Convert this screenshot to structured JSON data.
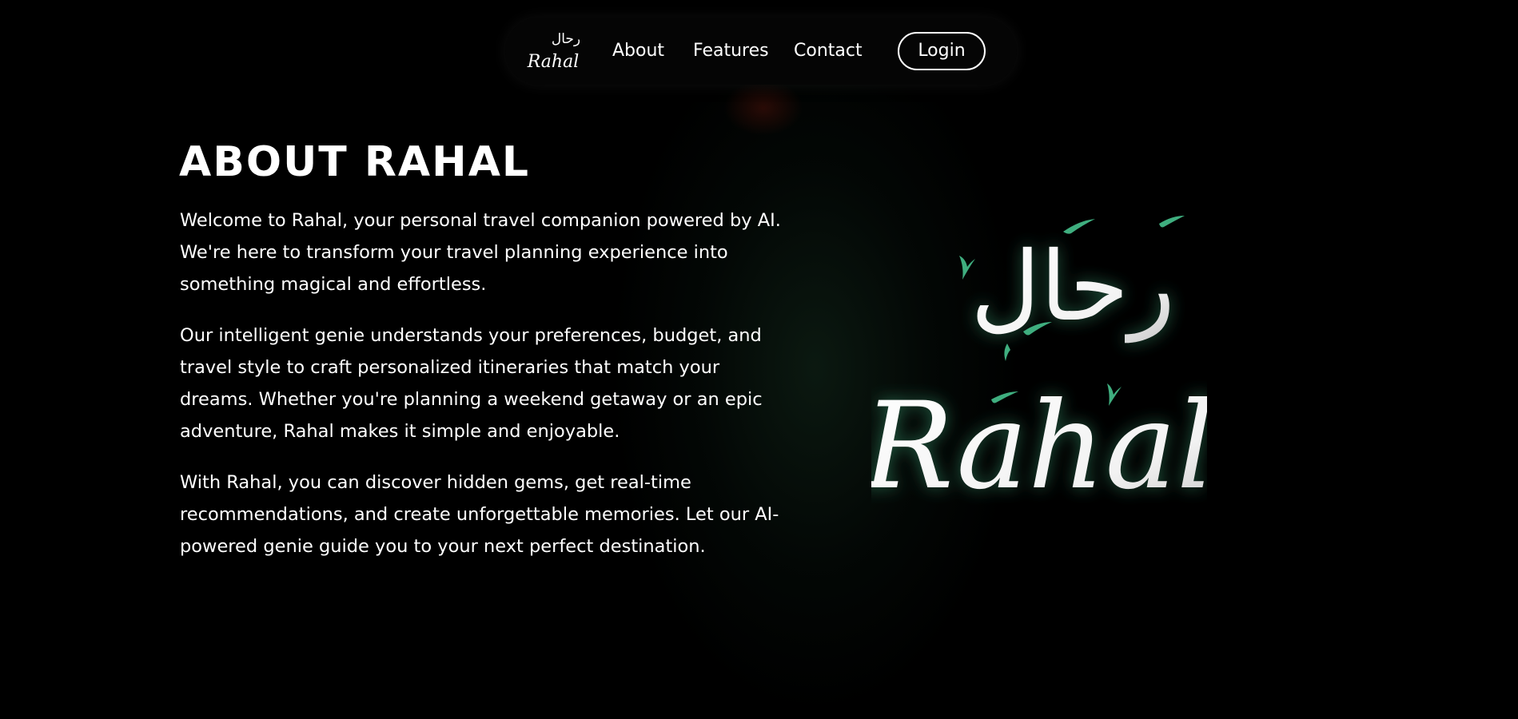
{
  "nav": {
    "logo_latin": "Rahal",
    "logo_arabic": "رحال",
    "links": [
      "About",
      "Features",
      "Contact"
    ],
    "login_label": "Login"
  },
  "main": {
    "title": "ABOUT RAHAL",
    "paragraphs": [
      "Welcome to Rahal, your personal travel companion powered by AI. We're here to transform your travel planning experience into something magical and effortless.",
      "Our intelligent genie understands your preferences, budget, and travel style to craft personalized itineraries that match your dreams. Whether you're planning a weekend getaway or an epic adventure, Rahal makes it simple and enjoyable.",
      "With Rahal, you can discover hidden gems, get real-time recommendations, and create unforgettable memories. Let our AI-powered genie guide you to your next perfect destination."
    ]
  },
  "hero": {
    "logo_latin": "Rahal",
    "logo_arabic": "رحال"
  },
  "colors": {
    "background": "#000000",
    "text": "#ffffff",
    "accent_green": "#3fae7f"
  }
}
